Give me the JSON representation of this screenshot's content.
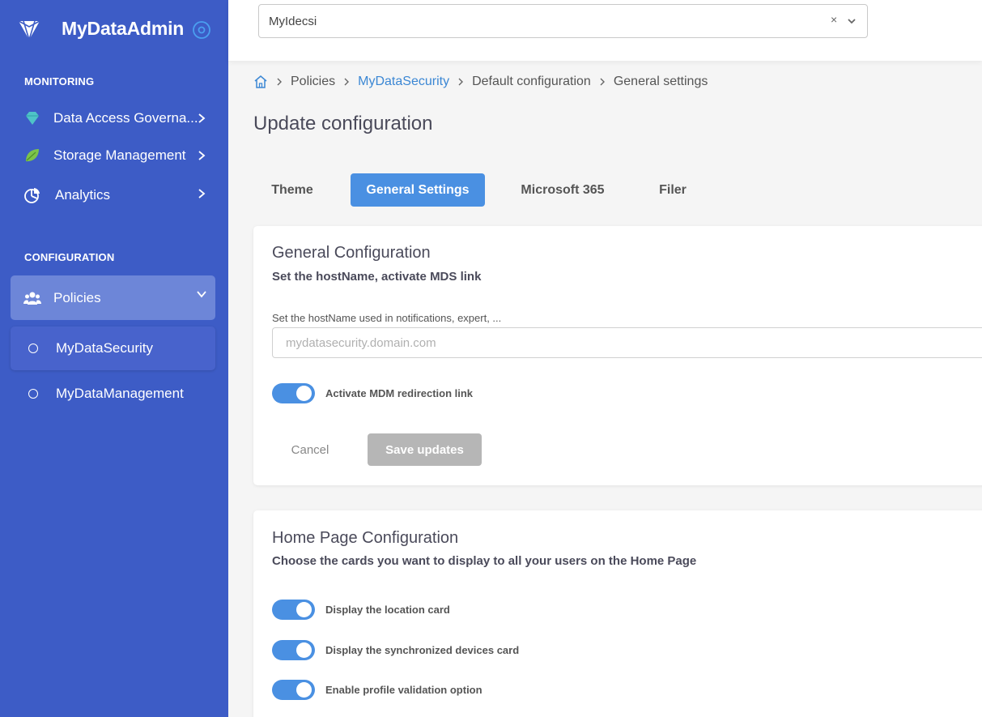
{
  "sidebar": {
    "brand": "MyDataAdmin",
    "monitoring_title": "MONITORING",
    "monitoring_items": [
      {
        "label": "Data Access Governa...",
        "icon": "gem-icon"
      },
      {
        "label": "Storage Management",
        "icon": "leaf-icon"
      },
      {
        "label": "Analytics",
        "icon": "pie-chart-icon"
      }
    ],
    "configuration_title": "CONFIGURATION",
    "policies_label": "Policies",
    "sub_items": [
      {
        "label": "MyDataSecurity"
      },
      {
        "label": "MyDataManagement"
      }
    ]
  },
  "topbar": {
    "tenant_value": "MyIdecsi",
    "clear_glyph": "×"
  },
  "breadcrumb": [
    "Policies",
    "MyDataSecurity",
    "Default configuration",
    "General settings"
  ],
  "page_title": "Update configuration",
  "tabs": [
    "Theme",
    "General Settings",
    "Microsoft 365",
    "Filer"
  ],
  "general_card": {
    "title": "General Configuration",
    "subtitle": "Set the hostName, activate MDS link",
    "field_label": "Set the hostName used in notifications, expert, ...",
    "field_placeholder": "mydatasecurity.domain.com",
    "toggle_label": "Activate MDM redirection link",
    "toggle_on": true,
    "cancel_label": "Cancel",
    "save_label": "Save updates"
  },
  "home_card": {
    "title": "Home Page Configuration",
    "subtitle": "Choose the cards you want to display to all your users on the Home Page",
    "toggles": [
      {
        "label": "Display the location card",
        "on": true
      },
      {
        "label": "Display the synchronized devices card",
        "on": true
      },
      {
        "label": "Enable profile validation option",
        "on": true
      }
    ]
  },
  "colors": {
    "sidebar": "#3d5cc6",
    "accent": "#4a90e2",
    "link": "#3b87d4"
  }
}
